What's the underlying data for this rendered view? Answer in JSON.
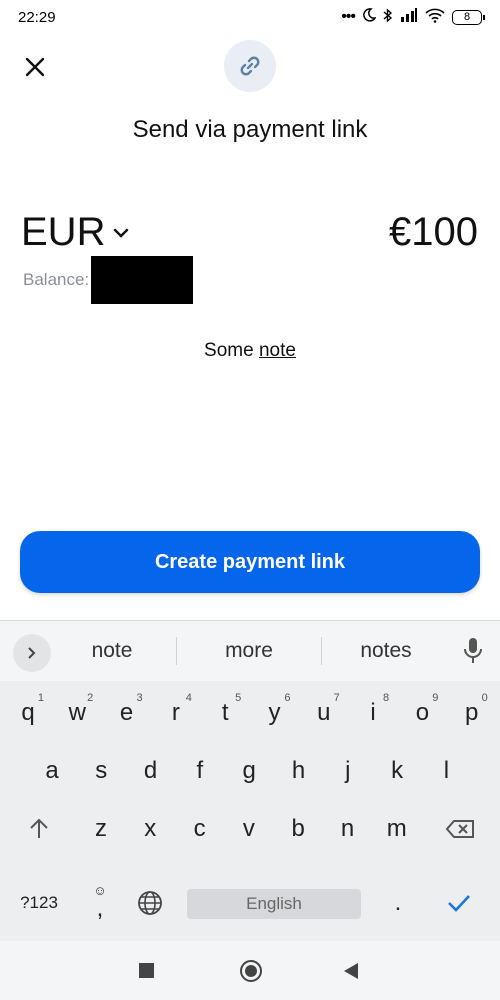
{
  "status_bar": {
    "time": "22:29",
    "battery_level": "8",
    "icons": [
      "more-dots-icon",
      "moon-icon",
      "bluetooth-icon",
      "signal-icon",
      "wifi-icon",
      "battery-icon"
    ]
  },
  "header": {
    "close_icon": "close-icon",
    "link_icon": "link-icon",
    "title": "Send via payment link"
  },
  "payment": {
    "currency": "EUR",
    "amount": "€100",
    "balance_label": "Balance:",
    "note_prefix": "Some",
    "note_link": "note"
  },
  "cta": {
    "label": "Create payment link",
    "color": "#0666eb"
  },
  "keyboard": {
    "suggestions": [
      "note",
      "more",
      "notes"
    ],
    "row1": [
      {
        "k": "q",
        "n": "1"
      },
      {
        "k": "w",
        "n": "2"
      },
      {
        "k": "e",
        "n": "3"
      },
      {
        "k": "r",
        "n": "4"
      },
      {
        "k": "t",
        "n": "5"
      },
      {
        "k": "y",
        "n": "6"
      },
      {
        "k": "u",
        "n": "7"
      },
      {
        "k": "i",
        "n": "8"
      },
      {
        "k": "o",
        "n": "9"
      },
      {
        "k": "p",
        "n": "0"
      }
    ],
    "row2": [
      "a",
      "s",
      "d",
      "f",
      "g",
      "h",
      "j",
      "k",
      "l"
    ],
    "row3": [
      "z",
      "x",
      "c",
      "v",
      "b",
      "n",
      "m"
    ],
    "symbols_label": "?123",
    "emoji_comma": ",",
    "space_label": "English",
    "period": ".",
    "accent_color": "#1a73e8"
  },
  "navbar": {
    "icons": [
      "recent-apps-icon",
      "home-icon",
      "back-icon"
    ]
  }
}
